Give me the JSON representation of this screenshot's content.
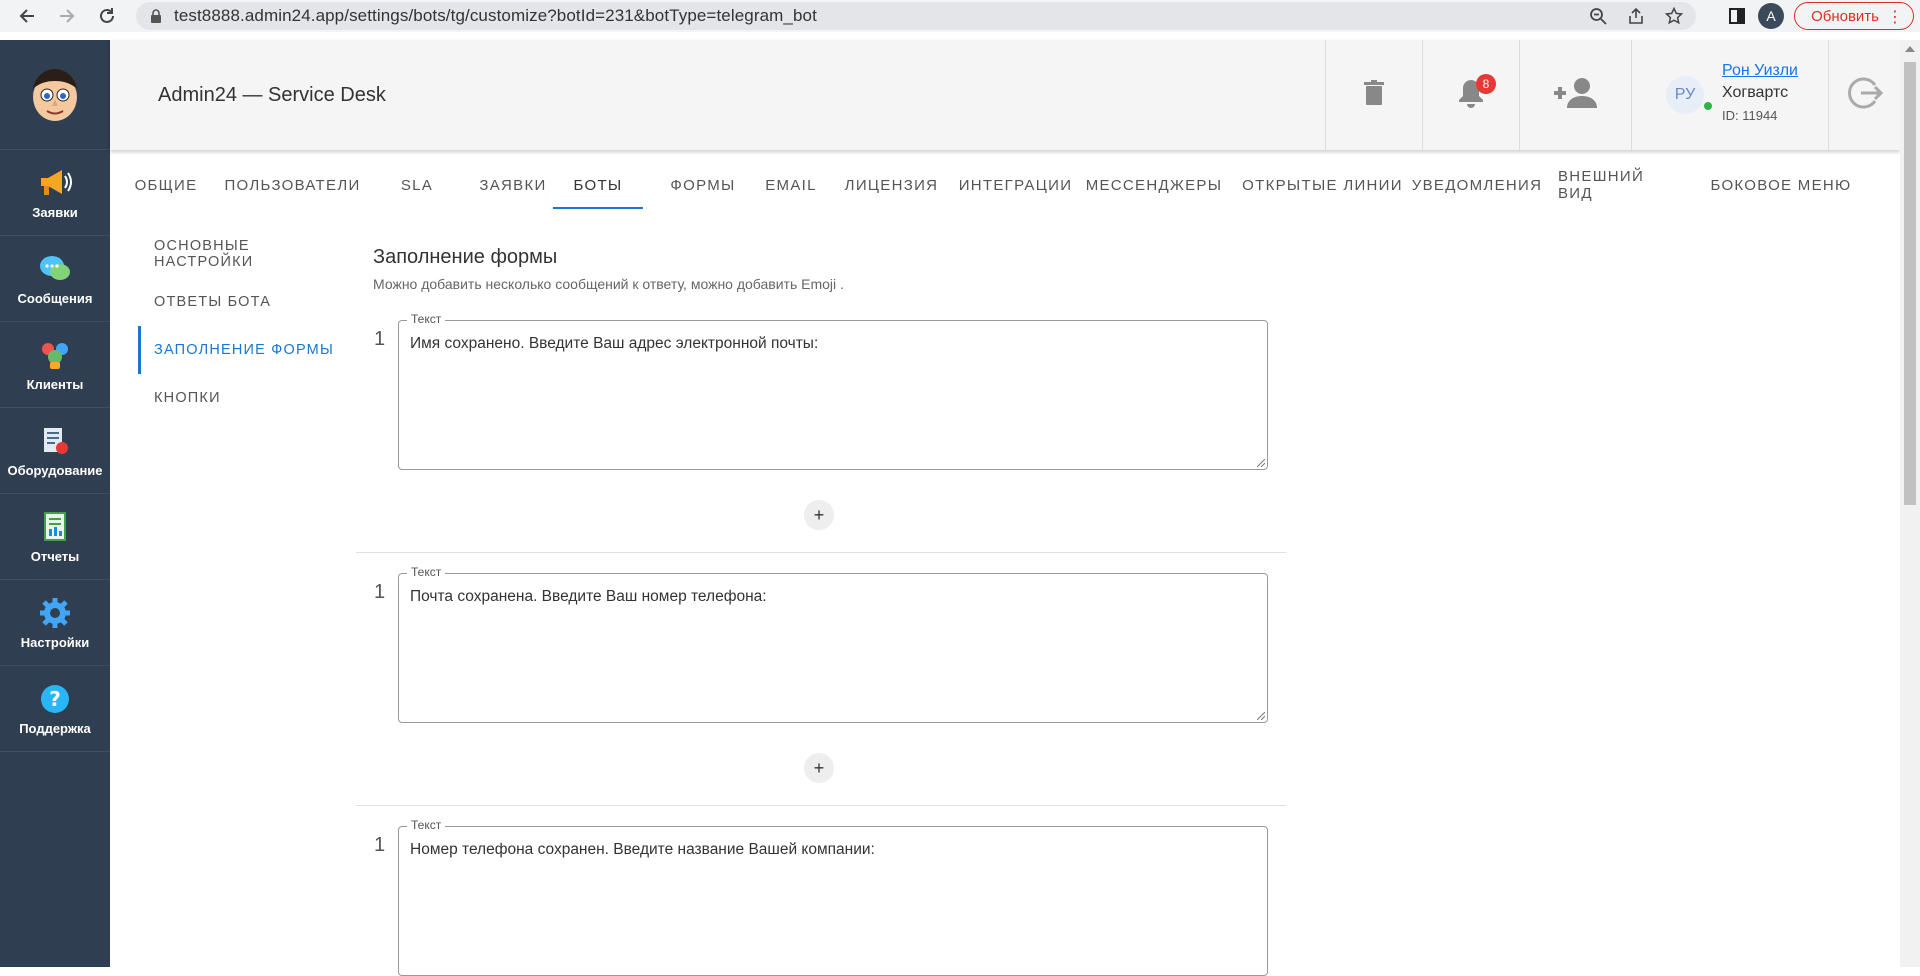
{
  "browser": {
    "url": "test8888.admin24.app/settings/bots/tg/customize?botId=231&botType=telegram_bot",
    "profile_initial": "A",
    "update_label": "Обновить"
  },
  "header": {
    "title": "Admin24 — Service Desk",
    "notifications_count": "8",
    "user": {
      "initials": "РУ",
      "name": "Рон Уизли",
      "org": "Хогвартс",
      "id": "ID: 11944"
    }
  },
  "sidebar": {
    "items": [
      {
        "label": "Заявки",
        "icon": "megaphone-icon"
      },
      {
        "label": "Сообщения",
        "icon": "chat-bubbles-icon"
      },
      {
        "label": "Клиенты",
        "icon": "clients-icon"
      },
      {
        "label": "Оборудование",
        "icon": "equipment-icon"
      },
      {
        "label": "Отчеты",
        "icon": "report-icon"
      },
      {
        "label": "Настройки",
        "icon": "gear-icon"
      },
      {
        "label": "Поддержка",
        "icon": "help-icon"
      }
    ]
  },
  "tabs": [
    {
      "label": "Общие"
    },
    {
      "label": "Пользователи"
    },
    {
      "label": "SLA"
    },
    {
      "label": "Заявки"
    },
    {
      "label": "Боты",
      "active": true
    },
    {
      "label": "Формы"
    },
    {
      "label": "Email"
    },
    {
      "label": "Лицензия"
    },
    {
      "label": "Интеграции"
    },
    {
      "label": "Мессенджеры"
    },
    {
      "label": "Открытые линии"
    },
    {
      "label": "Уведомления"
    },
    {
      "label": "Внешний вид"
    },
    {
      "label": "Боковое меню"
    }
  ],
  "submenu": [
    {
      "label": "Основные настройки"
    },
    {
      "label": "Ответы бота"
    },
    {
      "label": "Заполнение формы",
      "active": true
    },
    {
      "label": "Кнопки"
    }
  ],
  "content": {
    "title": "Заполнение формы",
    "description": "Можно добавить несколько сообщений к ответу, можно добавить Emoji .",
    "blocks": [
      {
        "number": "1",
        "field_label": "Текст",
        "value": "Имя сохранено. Введите Ваш адрес электронной почты:"
      },
      {
        "number": "1",
        "field_label": "Текст",
        "value": "Почта сохранена. Введите Ваш номер телефона:"
      },
      {
        "number": "1",
        "field_label": "Текст",
        "value": "Номер телефона сохранен. Введите название Вашей компании:"
      }
    ],
    "add_button_label": "+"
  },
  "colors": {
    "sidebar_bg": "#2f3e50",
    "accent": "#1976d2",
    "badge": "#e53935",
    "update_red": "#d93025"
  }
}
